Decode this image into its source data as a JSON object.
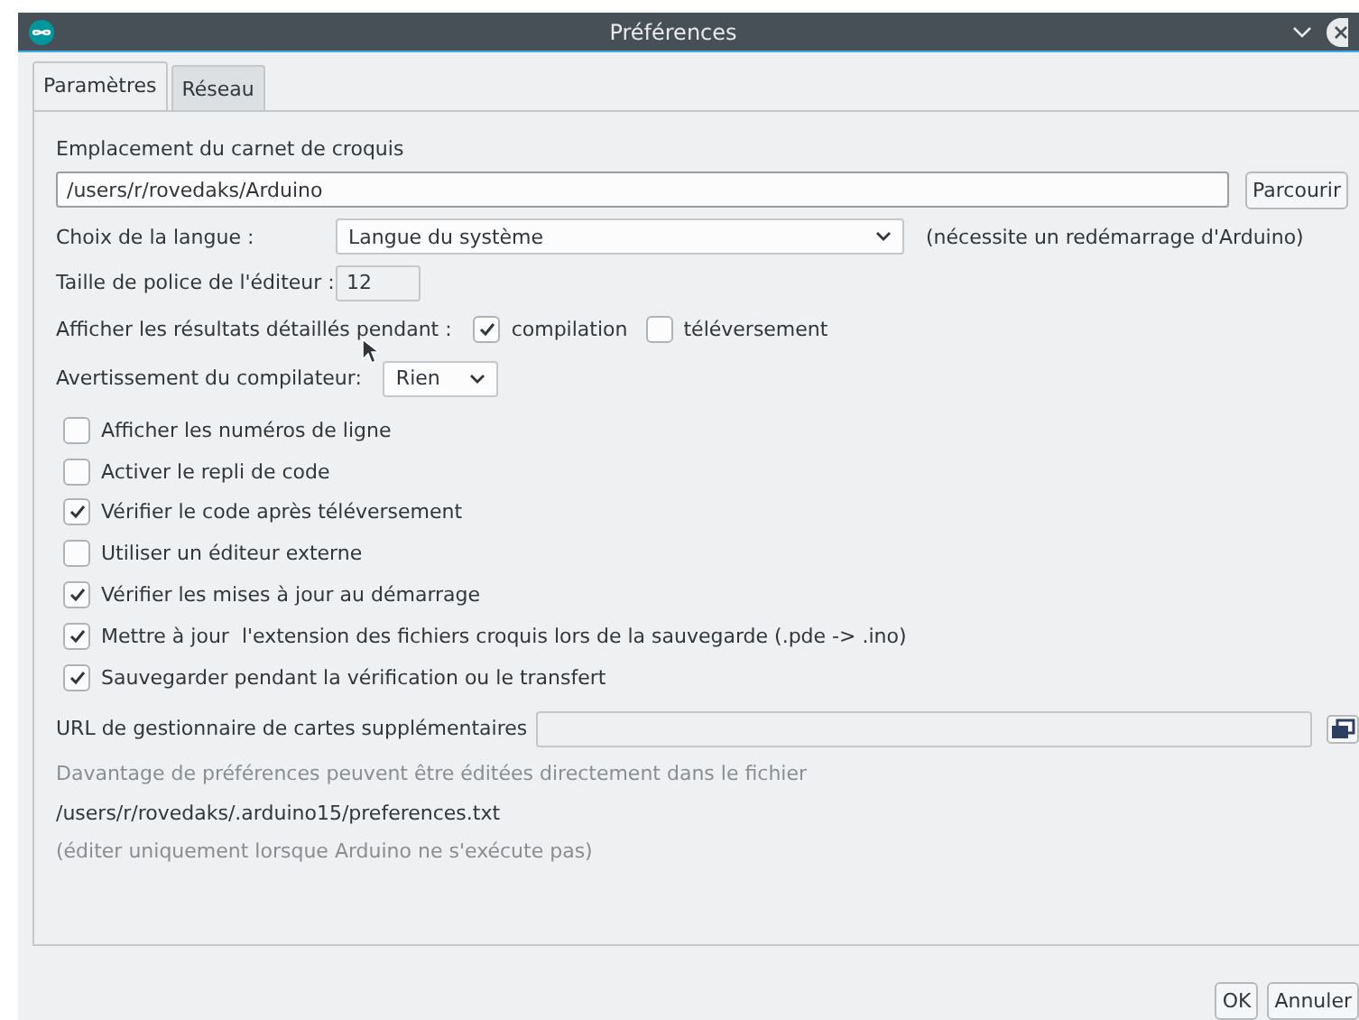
{
  "window": {
    "title": "Préférences"
  },
  "tabs": [
    {
      "label": "Paramètres",
      "selected": true
    },
    {
      "label": "Réseau",
      "selected": false
    }
  ],
  "sketchbook": {
    "label": "Emplacement du carnet de croquis",
    "value": "/users/r/rovedaks/Arduino",
    "button": "Parcourir"
  },
  "language": {
    "label": "Choix de la langue :",
    "value": "Langue du système",
    "note": "(nécessite un redémarrage d'Arduino)"
  },
  "font_size": {
    "label": "Taille de police de l'éditeur :",
    "value": "12"
  },
  "verbose": {
    "label": "Afficher les résultats détaillés pendant :",
    "options": [
      {
        "label": "compilation",
        "checked": true
      },
      {
        "label": "téléversement",
        "checked": false
      }
    ]
  },
  "compiler_warnings": {
    "label": "Avertissement du compilateur:",
    "value": "Rien"
  },
  "options": [
    {
      "label": "Afficher les numéros de ligne",
      "checked": false
    },
    {
      "label": "Activer le repli de code",
      "checked": false
    },
    {
      "label": "Vérifier le code après téléversement",
      "checked": true
    },
    {
      "label": "Utiliser un éditeur externe",
      "checked": false
    },
    {
      "label": "Vérifier les mises à jour au démarrage",
      "checked": true
    },
    {
      "label": "Mettre à jour  l'extension des fichiers croquis lors de la sauvegarde (.pde -> .ino)",
      "checked": true
    },
    {
      "label": "Sauvegarder pendant la vérification ou le transfert",
      "checked": true
    }
  ],
  "board_urls": {
    "label": "URL de gestionnaire de cartes supplémentaires"
  },
  "more_info": {
    "text": "Davantage de préférences peuvent être éditées directement dans le fichier",
    "path": "/users/r/rovedaks/.arduino15/preferences.txt",
    "note": "(éditer uniquement lorsque Arduino ne s'exécute pas)"
  },
  "buttons": [
    "OK",
    "Annuler"
  ]
}
